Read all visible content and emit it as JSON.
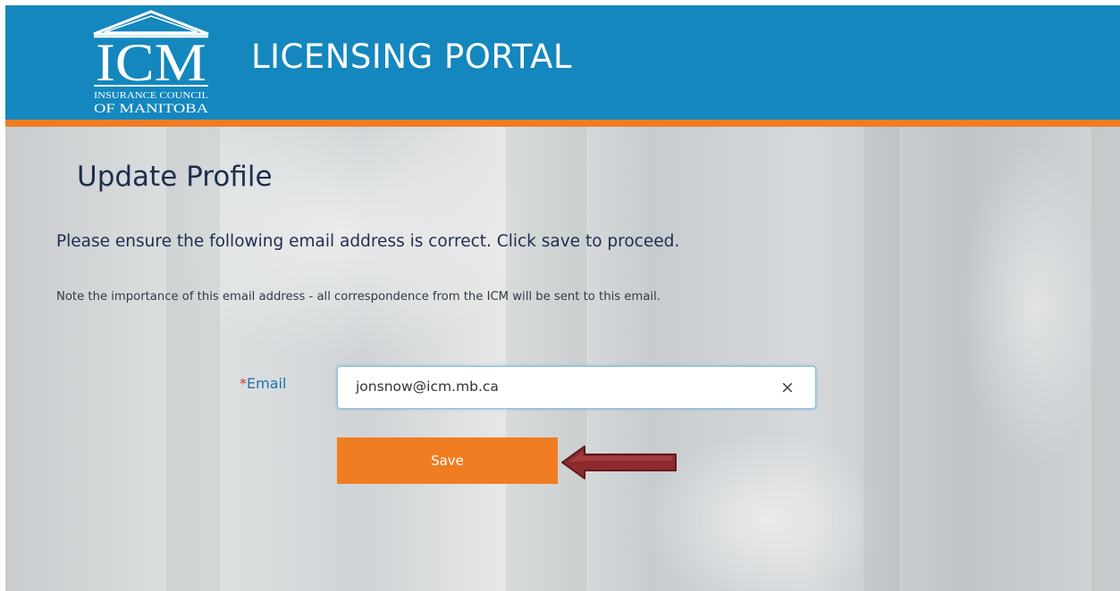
{
  "header": {
    "logo": {
      "letters": "ICM",
      "line1": "INSURANCE COUNCIL",
      "line2": "OF MANITOBA"
    },
    "portal_title": "LICENSING PORTAL"
  },
  "main": {
    "page_title": "Update Profile",
    "instruction": "Please ensure the following email address is correct. Click save to proceed.",
    "note": "Note the importance of this email address - all correspondence from the ICM will be sent to this email.",
    "email_field": {
      "required_marker": "*",
      "label": "Email",
      "value": "jonsnow@icm.mb.ca",
      "clear_icon": "×"
    },
    "save_button": {
      "label": "Save"
    }
  },
  "colors": {
    "header_bg": "#1487be",
    "accent_orange": "#f07d22",
    "title_navy": "#1f2d4e",
    "label_blue": "#1d74a8",
    "arrow_red": "#8e2a2d"
  },
  "icons": {
    "logo": "icm-building-logo-icon",
    "clear": "close-icon",
    "annotation": "left-arrow-icon"
  }
}
